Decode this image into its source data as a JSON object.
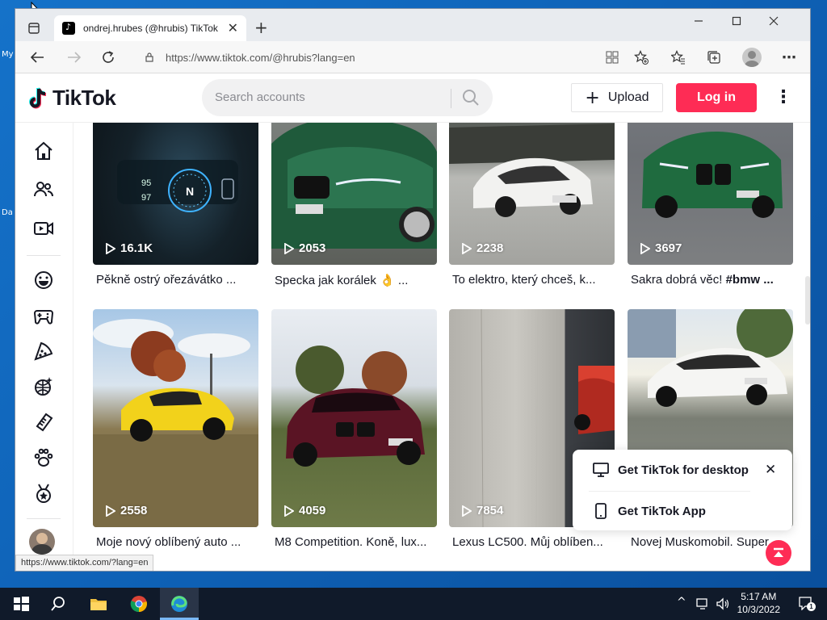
{
  "desktop": {
    "labels": [
      "My",
      "Da"
    ]
  },
  "browser": {
    "tab_title": "ondrej.hrubes (@hrubis) TikTok |",
    "url": "https://www.tiktok.com/@hrubis?lang=en",
    "status_url": "https://www.tiktok.com/?lang=en"
  },
  "header": {
    "logo": "TikTok",
    "search_placeholder": "Search accounts",
    "upload_label": "Upload",
    "login_label": "Log in"
  },
  "videos": [
    {
      "views": "16.1K",
      "caption": "Pěkně ostrý ořezávátko ..."
    },
    {
      "views": "2053",
      "caption": "Specka jak korálek 👌 ..."
    },
    {
      "views": "2238",
      "caption": "To elektro, který chceš, k..."
    },
    {
      "views": "3697",
      "caption": "Sakra dobrá věc! ",
      "caption_tag": "#bmw ..."
    },
    {
      "views": "2558",
      "caption": "Moje nový oblíbený auto ..."
    },
    {
      "views": "4059",
      "caption": "M8 Competition. Koně, lux..."
    },
    {
      "views": "7854",
      "caption": "Lexus LC500. Můj oblíben..."
    },
    {
      "views": "",
      "caption": "Novej Muskomobil. Super..."
    }
  ],
  "popup": {
    "desktop_label": "Get TikTok for desktop",
    "app_label": "Get TikTok App"
  },
  "taskbar": {
    "time": "5:17 AM",
    "date": "10/3/2022",
    "notifications": "1"
  },
  "colors": {
    "accent": "#fe2c55",
    "text": "#161823"
  }
}
